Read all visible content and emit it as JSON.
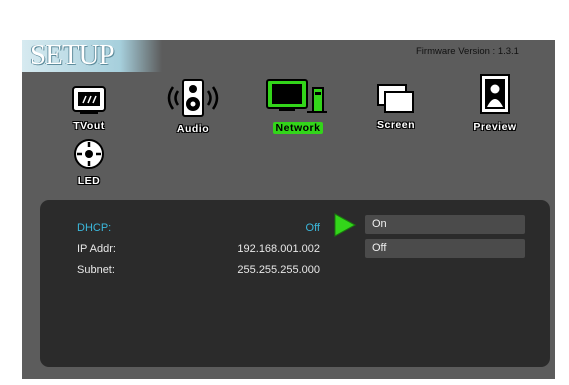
{
  "header": {
    "title": "SETUP",
    "firmware": "Firmware Version : 1.3.1"
  },
  "menu": {
    "tvout_label": "TVout",
    "audio_label": "Audio",
    "network_label": "Network",
    "screen_label": "Screen",
    "preview_label": "Preview",
    "led_label": "LED",
    "selected": "Network"
  },
  "settings": {
    "dhcp_label": "DHCP:",
    "dhcp_value": "Off",
    "ip_label": "IP Addr:",
    "ip_value": "192.168.001.002",
    "subnet_label": "Subnet:",
    "subnet_value": "255.255.255.000"
  },
  "dropdown": {
    "options": [
      "On",
      "Off"
    ]
  },
  "colors": {
    "accent_green": "#33d51a",
    "highlight_cyan": "#3bb8dc"
  }
}
